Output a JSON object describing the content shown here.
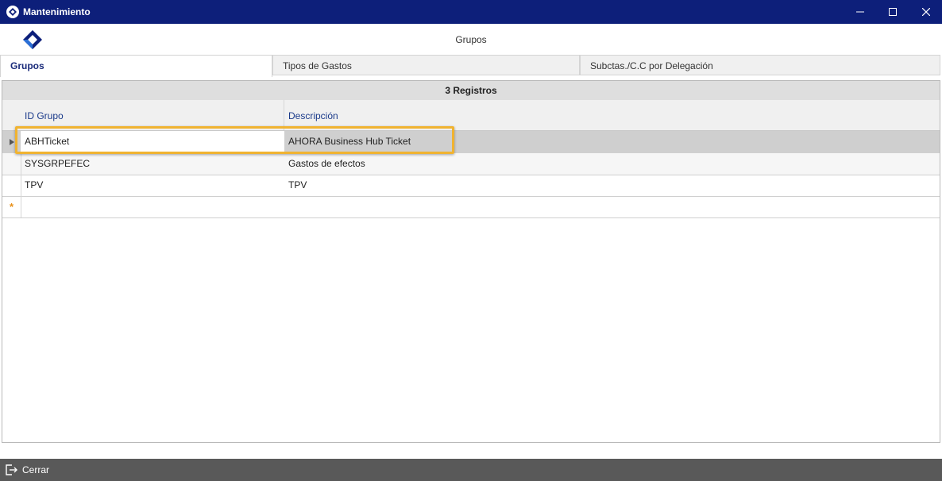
{
  "window": {
    "title": "Mantenimiento",
    "controls": {
      "minimize": "minimize-icon",
      "maximize": "maximize-icon",
      "close": "close-icon"
    }
  },
  "header": {
    "page_title": "Grupos"
  },
  "tabs": [
    {
      "label": "Grupos",
      "active": true
    },
    {
      "label": "Tipos de Gastos",
      "active": false
    },
    {
      "label": "Subctas./C.C por Delegación",
      "active": false
    }
  ],
  "grid": {
    "group_header": "3 Registros",
    "columns": [
      "ID Grupo",
      "Descripción"
    ],
    "rows": [
      {
        "id": "ABHTicket",
        "descripcion": "AHORA Business Hub Ticket",
        "selected": true
      },
      {
        "id": "SYSGRPEFEC",
        "descripcion": "Gastos de efectos",
        "selected": false
      },
      {
        "id": "TPV",
        "descripcion": "TPV",
        "selected": false
      }
    ],
    "new_row_indicator": "*"
  },
  "footer": {
    "close_label": "Cerrar"
  },
  "colors": {
    "titlebar": "#0d1f7a",
    "accent_text": "#1a3a8a",
    "highlight": "#f0b331",
    "footer": "#595959",
    "new_row_star": "#e8901a"
  }
}
